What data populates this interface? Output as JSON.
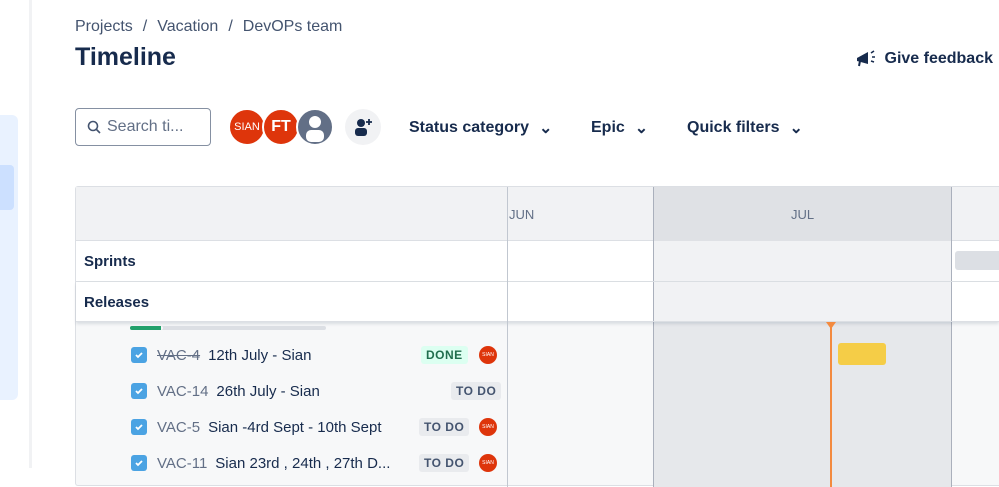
{
  "breadcrumbs": [
    "Projects",
    "Vacation",
    "DevOPs team"
  ],
  "title": "Timeline",
  "feedback_label": "Give feedback",
  "search": {
    "placeholder": "Search ti..."
  },
  "avatars": [
    {
      "initials": "SIAN",
      "color": "#de350b"
    },
    {
      "initials": "FT",
      "color": "#de350b"
    },
    {
      "initials": "",
      "color": "#626f86"
    }
  ],
  "filters": [
    "Status category",
    "Epic",
    "Quick filters"
  ],
  "timeline": {
    "months": [
      "JUN",
      "JUL"
    ],
    "rows": [
      "Sprints",
      "Releases"
    ],
    "progress_done_fraction": 0.17,
    "issues": [
      {
        "key": "VAC-4",
        "summary": "12th July - Sian",
        "status": "DONE",
        "assignee": "SIAN",
        "done": true
      },
      {
        "key": "VAC-14",
        "summary": "26th July - Sian",
        "status": "TO DO",
        "assignee": ""
      },
      {
        "key": "VAC-5",
        "summary": "Sian -4rd Sept - 10th Sept",
        "status": "TO DO",
        "assignee": "SIAN"
      },
      {
        "key": "VAC-11",
        "summary": "Sian 23rd , 24th , 27th D...",
        "status": "TO DO",
        "assignee": "SIAN"
      }
    ]
  },
  "colors": {
    "accent": "#0c66e4",
    "today": "#f38a3f",
    "bar": "#f5cd47"
  }
}
